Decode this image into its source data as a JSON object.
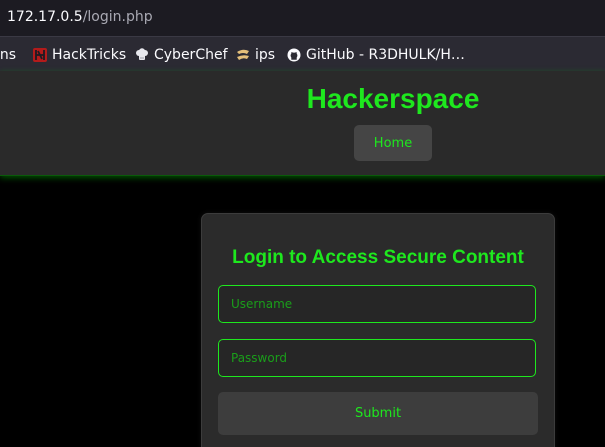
{
  "browser": {
    "url_host": "172.17.0.5",
    "url_path": "/login.php",
    "bookmarks": [
      {
        "label": "ins",
        "icon": "none"
      },
      {
        "label": "HackTricks",
        "icon": "hacktricks-icon"
      },
      {
        "label": "CyberChef",
        "icon": "chef-hat-icon"
      },
      {
        "label": "ips",
        "icon": "ips-icon"
      },
      {
        "label": "GitHub - R3DHULK/H…",
        "icon": "github-icon"
      }
    ]
  },
  "header": {
    "title": "Hackerspace",
    "nav": [
      {
        "label": "Home"
      }
    ]
  },
  "login": {
    "heading": "Login to Access Secure Content",
    "username_placeholder": "Username",
    "username_value": "",
    "password_placeholder": "Password",
    "password_value": "",
    "submit_label": "Submit"
  },
  "colors": {
    "accent_green": "#1ee81e",
    "page_bg": "#000000",
    "header_bg": "#2a2a2a",
    "card_bg": "#2b2b2b"
  }
}
